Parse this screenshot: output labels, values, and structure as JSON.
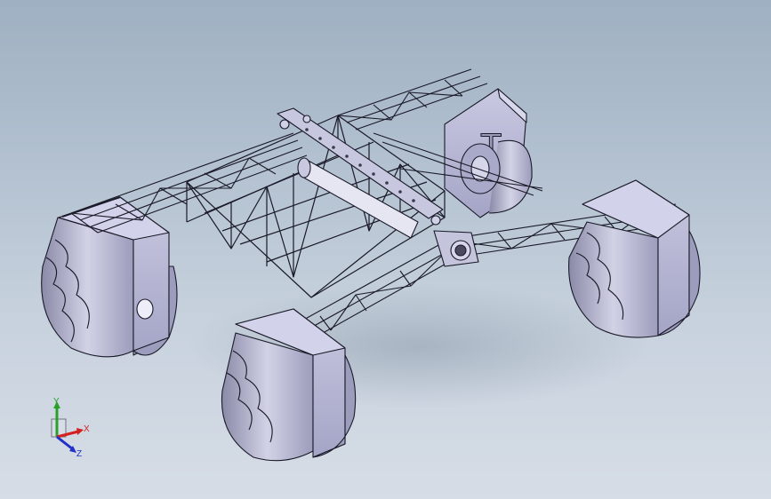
{
  "triad": {
    "x_label": "X",
    "y_label": "Y",
    "z_label": "Z",
    "x_color": "#d42020",
    "y_color": "#2aa02a",
    "z_color": "#2030c8"
  },
  "scene": {
    "background_top": "#9fb0c2",
    "background_bottom": "#d6dde6",
    "part_color": "#b7b7d6",
    "edge_color": "#1a1a28"
  }
}
